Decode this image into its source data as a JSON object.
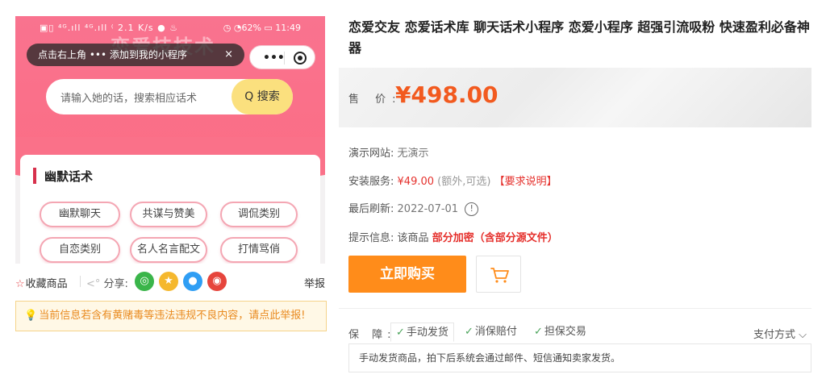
{
  "phone": {
    "status_left": "▣▯ ⁴ᴳ.ıll ⁴ᴳ.ıll ⁽ 2.1 K/s ● ♨",
    "status_right": "◷ ◔62% ▭ 11:49",
    "watermark": "恋爱技技术",
    "tip": "点击右上角 ••• 添加到我的小程序",
    "tip_close": "×",
    "capsule_dots": "•••",
    "search_placeholder": "请输入她的话，搜索相应话术",
    "search_button": "Q 搜索",
    "section_title": "幽默话术",
    "chips": [
      "幽默聊天",
      "共谋与赞美",
      "调侃类别",
      "自恋类别",
      "名人名言配文",
      "打情骂俏"
    ]
  },
  "share": {
    "favorite": "收藏商品",
    "share_label": "分享:",
    "icons": [
      "wechat-icon",
      "qzone-icon",
      "qq-icon",
      "weibo-icon"
    ],
    "report": "举报"
  },
  "notice": "当前信息若含有黄赌毒等违法违规不良内容，请点此举报!",
  "product": {
    "title": "恋爱交友 恋爱话术库 聊天话术小程序 恋爱小程序 超强引流吸粉 快速盈利必备神器",
    "price_label": "售 价:",
    "price": "¥498.00",
    "demo_label": "演示网站:",
    "demo_value": "无演示",
    "install_label": "安装服务:",
    "install_price": "¥49.00",
    "install_note": "(额外,可选)",
    "install_link": "【要求说明】",
    "refresh_label": "最后刷新:",
    "refresh_value": "2022-07-01",
    "tip_label": "提示信息:",
    "tip_prefix": "该商品",
    "tip_highlight": "部分加密（含部分源文件）",
    "buy_button": "立即购买"
  },
  "guarantee": {
    "label": "保 障:",
    "items": [
      "手动发货",
      "消保赔付",
      "担保交易"
    ],
    "payment": "支付方式",
    "description": "手动发货商品，拍下后系统会通过邮件、短信通知卖家发货。"
  },
  "colors": {
    "accent_orange": "#ff8c1a",
    "price_red": "#f25a1f",
    "pink": "#f9738f"
  }
}
